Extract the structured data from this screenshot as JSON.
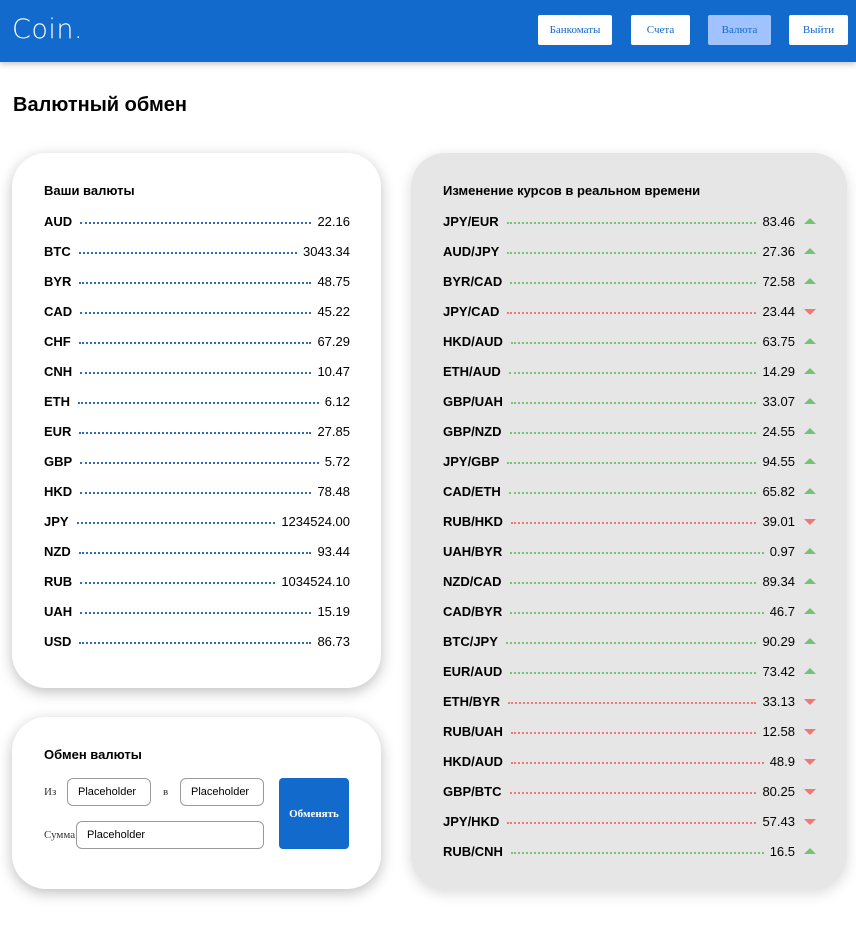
{
  "app": {
    "logo": "Coin."
  },
  "nav": {
    "items": [
      {
        "label": "Банкоматы",
        "active": false
      },
      {
        "label": "Счета",
        "active": false
      },
      {
        "label": "Валюта",
        "active": true
      },
      {
        "label": "Выйти",
        "active": false
      }
    ]
  },
  "page": {
    "title": "Валютный обмен"
  },
  "my_currencies": {
    "title": "Ваши валюты",
    "items": [
      {
        "code": "AUD",
        "amount": "22.16"
      },
      {
        "code": "BTC",
        "amount": "3043.34"
      },
      {
        "code": "BYR",
        "amount": "48.75"
      },
      {
        "code": "CAD",
        "amount": "45.22"
      },
      {
        "code": "CHF",
        "amount": "67.29"
      },
      {
        "code": "CNH",
        "amount": "10.47"
      },
      {
        "code": "ETH",
        "amount": "6.12"
      },
      {
        "code": "EUR",
        "amount": "27.85"
      },
      {
        "code": "GBP",
        "amount": "5.72"
      },
      {
        "code": "HKD",
        "amount": "78.48"
      },
      {
        "code": "JPY",
        "amount": "1234524.00"
      },
      {
        "code": "NZD",
        "amount": "93.44"
      },
      {
        "code": "RUB",
        "amount": "1034524.10"
      },
      {
        "code": "UAH",
        "amount": "15.19"
      },
      {
        "code": "USD",
        "amount": "86.73"
      }
    ]
  },
  "exchange": {
    "title": "Обмен валюты",
    "from_label": "Из",
    "to_label": "в",
    "amount_label": "Сумма",
    "from_placeholder": "Placeholder",
    "to_placeholder": "Placeholder",
    "amount_placeholder": "Placeholder",
    "button_label": "Обменять"
  },
  "rates": {
    "title": "Изменение курсов в реальном времени",
    "colors": {
      "up": "#74c276",
      "down": "#f07777"
    },
    "items": [
      {
        "pair": "JPY/EUR",
        "rate": "83.46",
        "trend": "up"
      },
      {
        "pair": "AUD/JPY",
        "rate": "27.36",
        "trend": "up"
      },
      {
        "pair": "BYR/CAD",
        "rate": "72.58",
        "trend": "up"
      },
      {
        "pair": "JPY/CAD",
        "rate": "23.44",
        "trend": "down"
      },
      {
        "pair": "HKD/AUD",
        "rate": "63.75",
        "trend": "up"
      },
      {
        "pair": "ETH/AUD",
        "rate": "14.29",
        "trend": "up"
      },
      {
        "pair": "GBP/UAH",
        "rate": "33.07",
        "trend": "up"
      },
      {
        "pair": "GBP/NZD",
        "rate": "24.55",
        "trend": "up"
      },
      {
        "pair": "JPY/GBP",
        "rate": "94.55",
        "trend": "up"
      },
      {
        "pair": "CAD/ETH",
        "rate": "65.82",
        "trend": "up"
      },
      {
        "pair": "RUB/HKD",
        "rate": "39.01",
        "trend": "down"
      },
      {
        "pair": "UAH/BYR",
        "rate": "0.97",
        "trend": "up"
      },
      {
        "pair": "NZD/CAD",
        "rate": "89.34",
        "trend": "up"
      },
      {
        "pair": "CAD/BYR",
        "rate": "46.7",
        "trend": "up"
      },
      {
        "pair": "BTC/JPY",
        "rate": "90.29",
        "trend": "up"
      },
      {
        "pair": "EUR/AUD",
        "rate": "73.42",
        "trend": "up"
      },
      {
        "pair": "ETH/BYR",
        "rate": "33.13",
        "trend": "down"
      },
      {
        "pair": "RUB/UAH",
        "rate": "12.58",
        "trend": "down"
      },
      {
        "pair": "HKD/AUD",
        "rate": "48.9",
        "trend": "down"
      },
      {
        "pair": "GBP/BTC",
        "rate": "80.25",
        "trend": "down"
      },
      {
        "pair": "JPY/HKD",
        "rate": "57.43",
        "trend": "down"
      },
      {
        "pair": "RUB/CNH",
        "rate": "16.5",
        "trend": "up"
      }
    ]
  }
}
